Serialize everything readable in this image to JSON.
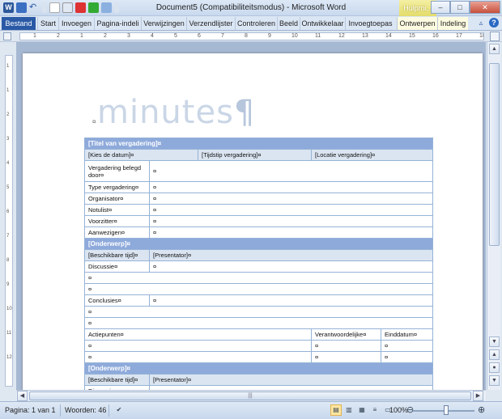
{
  "window": {
    "title": "Document5 (Compatibiliteitsmodus) - Microsoft Word",
    "contextual_group": "Hulpmi...",
    "controls": {
      "minimize": "–",
      "maximize": "□",
      "close": "✕"
    }
  },
  "qat": {
    "word_logo": "W",
    "undo": "↶",
    "redo": "↷"
  },
  "ribbon": {
    "file_tab": "Bestand",
    "tabs": [
      "Start",
      "Invoegen",
      "Pagina-indeli",
      "Verwijzingen",
      "Verzendlijster",
      "Controleren",
      "Beeld",
      "Ontwikkelaar",
      "Invoegtoepas",
      "Ontwerpen",
      "Indeling"
    ],
    "right": {
      "collapse": "▵",
      "help": "?"
    }
  },
  "ruler": {
    "h_marks": [
      "1",
      "2",
      "1",
      "2",
      "3",
      "4",
      "5",
      "6",
      "7",
      "8",
      "9",
      "10",
      "11",
      "12",
      "13",
      "14",
      "15",
      "16",
      "17",
      "18"
    ],
    "v_marks": [
      "1",
      "1",
      "2",
      "3",
      "4",
      "5",
      "6",
      "7",
      "8",
      "9",
      "10",
      "11",
      "12"
    ]
  },
  "document": {
    "heading": "minutes",
    "pilcrow": "¶",
    "mark": "¤",
    "table": {
      "title": "[Titel van vergadering]¤",
      "date": "[Kies de datum]¤",
      "time": "[Tijdstip vergadering]¤",
      "location": "[Locatie vergadering]¤",
      "fields": [
        {
          "label": "Vergadering belegd door¤",
          "value": "¤"
        },
        {
          "label": "Type vergadering¤",
          "value": "¤"
        },
        {
          "label": "Organisator¤",
          "value": "¤"
        },
        {
          "label": "Notulist¤",
          "value": "¤"
        },
        {
          "label": "Voorzitter¤",
          "value": "¤"
        },
        {
          "label": "Aanwezigen¤",
          "value": "¤"
        }
      ],
      "topic": "[Onderwerp]¤",
      "time_alloc": "[Beschikbare tijd]¤",
      "presenter": "[Presentator]¤",
      "discussion": "Discussie¤",
      "conclusions": "Conclusies¤",
      "actions": "Actiepunten¤",
      "responsible": "Verantwoordelijke¤",
      "deadline": "Einddatum¤",
      "empty": "¤"
    }
  },
  "status": {
    "page": "Pagina: 1 van 1",
    "words": "Woorden: 46",
    "zoom": "100%",
    "zoom_minus": "⊖",
    "zoom_plus": "⊕"
  }
}
